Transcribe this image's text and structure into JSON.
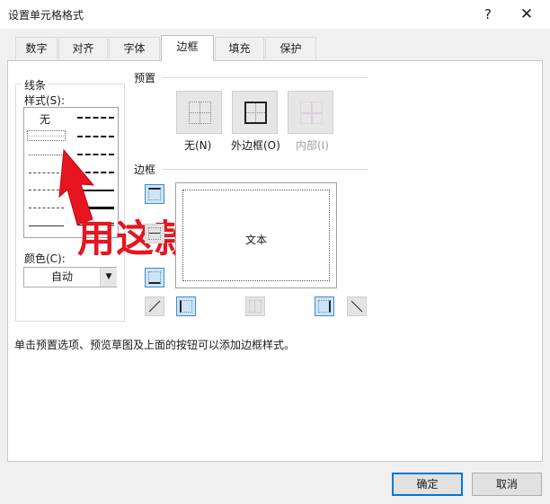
{
  "window": {
    "title": "设置单元格格式",
    "help": "?",
    "close": "✕"
  },
  "tabs": [
    "数字",
    "对齐",
    "字体",
    "边框",
    "填充",
    "保护"
  ],
  "active_tab": "边框",
  "line_group": {
    "title": "线条",
    "style_label": "样式(S):",
    "none_label": "无",
    "color_label": "颜色(C):",
    "color_value": "自动"
  },
  "presets": {
    "title": "预置",
    "items": [
      {
        "label": "无(N)",
        "enabled": true
      },
      {
        "label": "外边框(O)",
        "enabled": true
      },
      {
        "label": "内部(I)",
        "enabled": false
      }
    ]
  },
  "border_section": {
    "title": "边框",
    "preview_text": "文本"
  },
  "hint": "单击预置选项、预览草图及上面的按钮可以添加边框样式。",
  "annotation": {
    "text": "用这款",
    "color": "#e6151f"
  },
  "buttons": {
    "ok": "确定",
    "cancel": "取消"
  },
  "colors": {
    "accent": "#0078d7",
    "selected_bg": "#cce4f7",
    "arrow": "#e6151f"
  }
}
